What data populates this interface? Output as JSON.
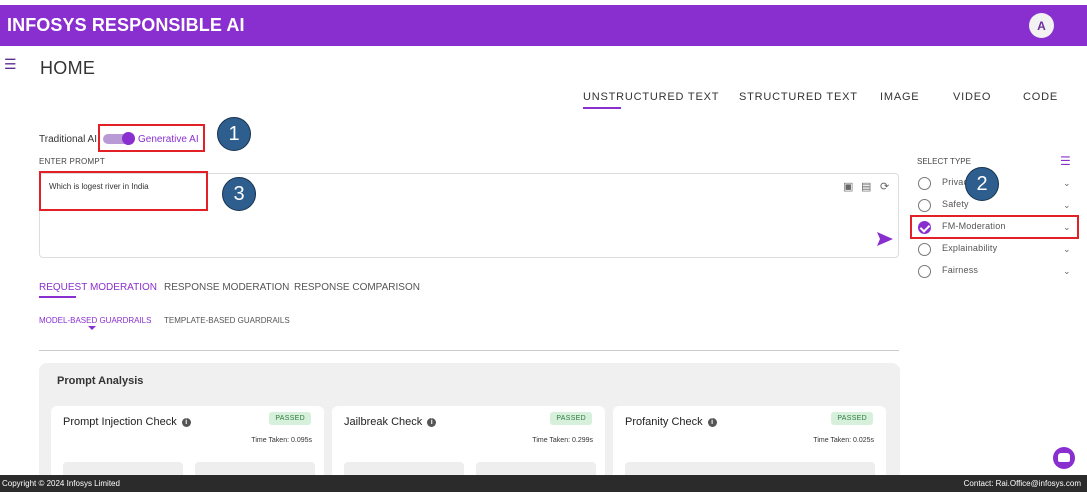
{
  "app": {
    "title": "INFOSYS RESPONSIBLE AI",
    "avatar_initial": "A"
  },
  "page": {
    "title": "HOME"
  },
  "top_tabs": [
    "UNSTRUCTURED TEXT",
    "STRUCTURED TEXT",
    "IMAGE",
    "VIDEO",
    "CODE"
  ],
  "mode_toggle": {
    "left_label": "Traditional AI",
    "right_label": "Generative AI",
    "selected": "Generative AI"
  },
  "prompt": {
    "label": "ENTER PROMPT",
    "value": "Which is logest river in India"
  },
  "select_type": {
    "label": "SELECT TYPE",
    "options": [
      "Privacy",
      "Safety",
      "FM-Moderation",
      "Explainability",
      "Fairness"
    ],
    "selected": "FM-Moderation"
  },
  "callouts": [
    "1",
    "2",
    "3"
  ],
  "moderation_tabs": [
    "REQUEST MODERATION",
    "RESPONSE MODERATION",
    "RESPONSE COMPARISON"
  ],
  "guardrail_tabs": [
    "MODEL-BASED GUARDRAILS",
    "TEMPLATE-BASED GUARDRAILS"
  ],
  "analysis": {
    "title": "Prompt Analysis",
    "checks": [
      {
        "name": "Prompt Injection Check",
        "status": "PASSED",
        "time": "Time Taken: 0.095s"
      },
      {
        "name": "Jailbreak Check",
        "status": "PASSED",
        "time": "Time Taken: 0.299s"
      },
      {
        "name": "Profanity Check",
        "status": "PASSED",
        "time": "Time Taken: 0.025s"
      }
    ]
  },
  "footer": {
    "copyright": "Copyright © 2024 Infosys Limited",
    "contact": "Contact: Rai.Office@infosys.com"
  },
  "colors": {
    "brand": "#8a2fcf",
    "annotation_red": "#e32026",
    "callout_blue": "#2d5e8e",
    "passed_bg": "#d7f0dc"
  }
}
